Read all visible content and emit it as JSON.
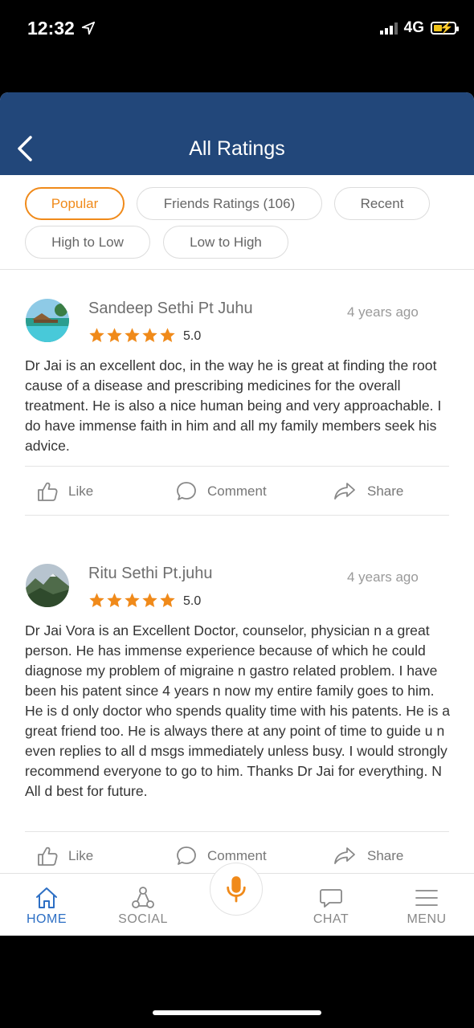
{
  "status_bar": {
    "time": "12:32",
    "network": "4G"
  },
  "header": {
    "title": "All Ratings"
  },
  "filters": [
    {
      "label": "Popular",
      "active": true
    },
    {
      "label": "Friends Ratings (106)",
      "active": false
    },
    {
      "label": "Recent",
      "active": false
    },
    {
      "label": "High to Low",
      "active": false
    },
    {
      "label": "Low to High",
      "active": false
    }
  ],
  "reviews": [
    {
      "name": "Sandeep Sethi Pt Juhu",
      "time_ago": "4 years ago",
      "stars": 5,
      "rating": "5.0",
      "text": "Dr Jai is an excellent doc, in the way he is great at finding the root cause of a disease and prescribing medicines for the overall treatment. He is also a nice human being and very approachable. I do have immense faith in him and all my family members seek his advice."
    },
    {
      "name": "Ritu Sethi Pt.juhu",
      "time_ago": "4 years ago",
      "stars": 5,
      "rating": "5.0",
      "text": "Dr Jai Vora is an Excellent Doctor, counselor, physician n a great person. He has immense experience because of which he could diagnose my problem of migraine n gastro related problem. I have been his patent since 4 years n now my entire family goes to him. He is d only doctor who spends quality time with his patents. He is a great friend too. He is always there at any point of time to guide u n even replies to all d msgs immediately unless busy. I would strongly recommend everyone to go to him. Thanks Dr Jai for everything. N All d best for future."
    }
  ],
  "actions": {
    "like": "Like",
    "comment": "Comment",
    "share": "Share"
  },
  "bottom_nav": {
    "home": "HOME",
    "social": "SOCIAL",
    "chat": "CHAT",
    "menu": "MENU"
  },
  "colors": {
    "header_bg": "#22477a",
    "accent": "#f08a1a",
    "star": "#f08a1a",
    "nav_active": "#2d6fc4"
  }
}
